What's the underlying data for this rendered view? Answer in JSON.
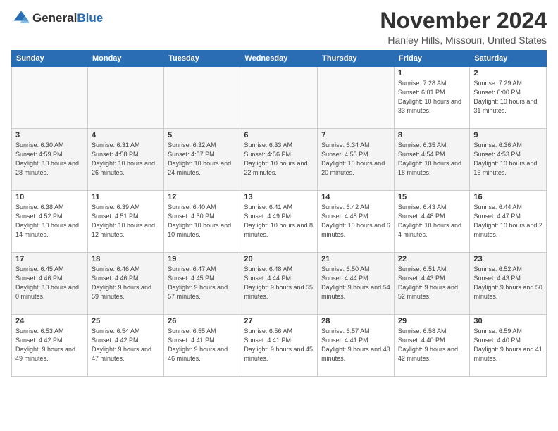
{
  "header": {
    "logo_general": "General",
    "logo_blue": "Blue",
    "month_year": "November 2024",
    "location": "Hanley Hills, Missouri, United States"
  },
  "weekdays": [
    "Sunday",
    "Monday",
    "Tuesday",
    "Wednesday",
    "Thursday",
    "Friday",
    "Saturday"
  ],
  "weeks": [
    [
      {
        "day": "",
        "info": ""
      },
      {
        "day": "",
        "info": ""
      },
      {
        "day": "",
        "info": ""
      },
      {
        "day": "",
        "info": ""
      },
      {
        "day": "",
        "info": ""
      },
      {
        "day": "1",
        "info": "Sunrise: 7:28 AM\nSunset: 6:01 PM\nDaylight: 10 hours and 33 minutes."
      },
      {
        "day": "2",
        "info": "Sunrise: 7:29 AM\nSunset: 6:00 PM\nDaylight: 10 hours and 31 minutes."
      }
    ],
    [
      {
        "day": "3",
        "info": "Sunrise: 6:30 AM\nSunset: 4:59 PM\nDaylight: 10 hours and 28 minutes."
      },
      {
        "day": "4",
        "info": "Sunrise: 6:31 AM\nSunset: 4:58 PM\nDaylight: 10 hours and 26 minutes."
      },
      {
        "day": "5",
        "info": "Sunrise: 6:32 AM\nSunset: 4:57 PM\nDaylight: 10 hours and 24 minutes."
      },
      {
        "day": "6",
        "info": "Sunrise: 6:33 AM\nSunset: 4:56 PM\nDaylight: 10 hours and 22 minutes."
      },
      {
        "day": "7",
        "info": "Sunrise: 6:34 AM\nSunset: 4:55 PM\nDaylight: 10 hours and 20 minutes."
      },
      {
        "day": "8",
        "info": "Sunrise: 6:35 AM\nSunset: 4:54 PM\nDaylight: 10 hours and 18 minutes."
      },
      {
        "day": "9",
        "info": "Sunrise: 6:36 AM\nSunset: 4:53 PM\nDaylight: 10 hours and 16 minutes."
      }
    ],
    [
      {
        "day": "10",
        "info": "Sunrise: 6:38 AM\nSunset: 4:52 PM\nDaylight: 10 hours and 14 minutes."
      },
      {
        "day": "11",
        "info": "Sunrise: 6:39 AM\nSunset: 4:51 PM\nDaylight: 10 hours and 12 minutes."
      },
      {
        "day": "12",
        "info": "Sunrise: 6:40 AM\nSunset: 4:50 PM\nDaylight: 10 hours and 10 minutes."
      },
      {
        "day": "13",
        "info": "Sunrise: 6:41 AM\nSunset: 4:49 PM\nDaylight: 10 hours and 8 minutes."
      },
      {
        "day": "14",
        "info": "Sunrise: 6:42 AM\nSunset: 4:48 PM\nDaylight: 10 hours and 6 minutes."
      },
      {
        "day": "15",
        "info": "Sunrise: 6:43 AM\nSunset: 4:48 PM\nDaylight: 10 hours and 4 minutes."
      },
      {
        "day": "16",
        "info": "Sunrise: 6:44 AM\nSunset: 4:47 PM\nDaylight: 10 hours and 2 minutes."
      }
    ],
    [
      {
        "day": "17",
        "info": "Sunrise: 6:45 AM\nSunset: 4:46 PM\nDaylight: 10 hours and 0 minutes."
      },
      {
        "day": "18",
        "info": "Sunrise: 6:46 AM\nSunset: 4:46 PM\nDaylight: 9 hours and 59 minutes."
      },
      {
        "day": "19",
        "info": "Sunrise: 6:47 AM\nSunset: 4:45 PM\nDaylight: 9 hours and 57 minutes."
      },
      {
        "day": "20",
        "info": "Sunrise: 6:48 AM\nSunset: 4:44 PM\nDaylight: 9 hours and 55 minutes."
      },
      {
        "day": "21",
        "info": "Sunrise: 6:50 AM\nSunset: 4:44 PM\nDaylight: 9 hours and 54 minutes."
      },
      {
        "day": "22",
        "info": "Sunrise: 6:51 AM\nSunset: 4:43 PM\nDaylight: 9 hours and 52 minutes."
      },
      {
        "day": "23",
        "info": "Sunrise: 6:52 AM\nSunset: 4:43 PM\nDaylight: 9 hours and 50 minutes."
      }
    ],
    [
      {
        "day": "24",
        "info": "Sunrise: 6:53 AM\nSunset: 4:42 PM\nDaylight: 9 hours and 49 minutes."
      },
      {
        "day": "25",
        "info": "Sunrise: 6:54 AM\nSunset: 4:42 PM\nDaylight: 9 hours and 47 minutes."
      },
      {
        "day": "26",
        "info": "Sunrise: 6:55 AM\nSunset: 4:41 PM\nDaylight: 9 hours and 46 minutes."
      },
      {
        "day": "27",
        "info": "Sunrise: 6:56 AM\nSunset: 4:41 PM\nDaylight: 9 hours and 45 minutes."
      },
      {
        "day": "28",
        "info": "Sunrise: 6:57 AM\nSunset: 4:41 PM\nDaylight: 9 hours and 43 minutes."
      },
      {
        "day": "29",
        "info": "Sunrise: 6:58 AM\nSunset: 4:40 PM\nDaylight: 9 hours and 42 minutes."
      },
      {
        "day": "30",
        "info": "Sunrise: 6:59 AM\nSunset: 4:40 PM\nDaylight: 9 hours and 41 minutes."
      }
    ]
  ]
}
